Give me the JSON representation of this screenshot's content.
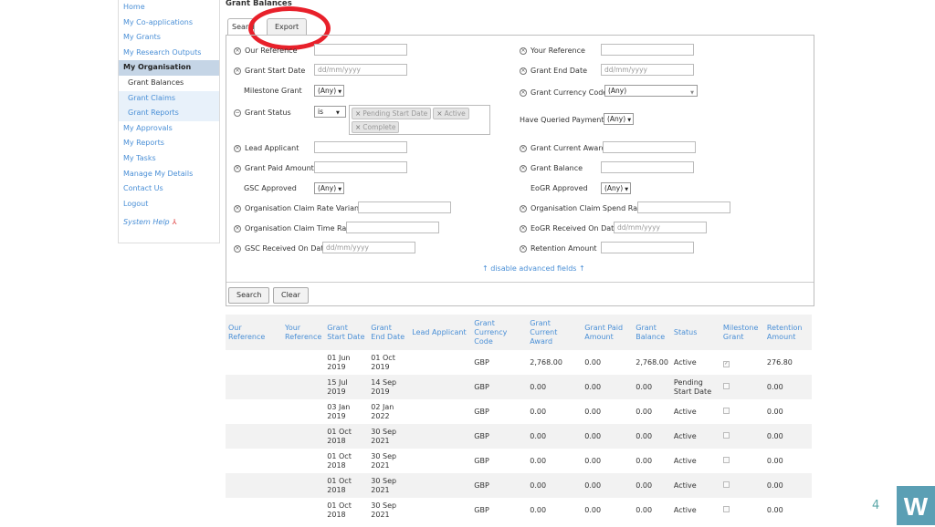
{
  "sidebar": {
    "items": [
      {
        "label": "Home",
        "type": "link"
      },
      {
        "label": "My Co-applications",
        "type": "link"
      },
      {
        "label": "My Grants",
        "type": "link"
      },
      {
        "label": "My Research Outputs",
        "type": "link"
      },
      {
        "label": "My Organisation",
        "type": "active"
      },
      {
        "label": "Grant Balances",
        "type": "sub-current"
      },
      {
        "label": "Grant Claims",
        "type": "sub"
      },
      {
        "label": "Grant Reports",
        "type": "sub"
      },
      {
        "label": "My Approvals",
        "type": "link"
      },
      {
        "label": "My Reports",
        "type": "link"
      },
      {
        "label": "My Tasks",
        "type": "link"
      },
      {
        "label": "Manage My Details",
        "type": "link"
      },
      {
        "label": "Contact Us",
        "type": "link"
      },
      {
        "label": "Logout",
        "type": "link"
      }
    ],
    "help": "System Help"
  },
  "page_title": "Grant Balances",
  "tabs": {
    "search": "Search",
    "export": "Export"
  },
  "form": {
    "our_reference": "Our Reference",
    "your_reference": "Your Reference",
    "grant_start_date": "Grant Start Date",
    "grant_end_date": "Grant End Date",
    "date_placeholder": "dd/mm/yyyy",
    "milestone_grant": "Milestone Grant",
    "grant_currency_code": "Grant Currency Code",
    "any": "(Any)",
    "grant_status": "Grant Status",
    "status_operator": "is",
    "status_tags": [
      "Pending Start Date",
      "Active",
      "Complete"
    ],
    "have_queried_payments": "Have Queried Payments",
    "lead_applicant": "Lead Applicant",
    "grant_current_award": "Grant Current Award",
    "grant_paid_amount": "Grant Paid Amount",
    "grant_balance": "Grant Balance",
    "gsc_approved": "GSC Approved",
    "eogr_approved": "EoGR Approved",
    "org_claim_rate_variance": "Organisation Claim Rate Variance",
    "org_claim_spend_rate": "Organisation Claim Spend Rate",
    "org_claim_time_rate": "Organisation Claim Time Rate",
    "eogr_received_on_date": "EoGR Received On Date",
    "gsc_received_on_date": "GSC Received On Date",
    "retention_amount": "Retention Amount",
    "disable_advanced": "↑ disable advanced fields ↑",
    "search_button": "Search",
    "clear_button": "Clear"
  },
  "table": {
    "headers": [
      "Our Reference",
      "Your Reference",
      "Grant Start Date",
      "Grant End Date",
      "Lead Applicant",
      "Grant Currency Code",
      "Grant Current Award",
      "Grant Paid Amount",
      "Grant Balance",
      "Status",
      "Milestone Grant",
      "Retention Amount"
    ],
    "rows": [
      [
        "",
        "",
        "01 Jun 2019",
        "01 Oct 2019",
        "",
        "GBP",
        "2,768.00",
        "0.00",
        "2,768.00",
        "Active",
        true,
        "276.80"
      ],
      [
        "",
        "",
        "15 Jul 2019",
        "14 Sep 2019",
        "",
        "GBP",
        "0.00",
        "0.00",
        "0.00",
        "Pending Start Date",
        false,
        "0.00"
      ],
      [
        "",
        "",
        "03 Jan 2019",
        "02 Jan 2022",
        "",
        "GBP",
        "0.00",
        "0.00",
        "0.00",
        "Active",
        false,
        "0.00"
      ],
      [
        "",
        "",
        "01 Oct 2018",
        "30 Sep 2021",
        "",
        "GBP",
        "0.00",
        "0.00",
        "0.00",
        "Active",
        false,
        "0.00"
      ],
      [
        "",
        "",
        "01 Oct 2018",
        "30 Sep 2021",
        "",
        "GBP",
        "0.00",
        "0.00",
        "0.00",
        "Active",
        false,
        "0.00"
      ],
      [
        "",
        "",
        "01 Oct 2018",
        "30 Sep 2021",
        "",
        "GBP",
        "0.00",
        "0.00",
        "0.00",
        "Active",
        false,
        "0.00"
      ],
      [
        "",
        "",
        "01 Oct 2018",
        "30 Sep 2021",
        "",
        "GBP",
        "0.00",
        "0.00",
        "0.00",
        "Active",
        false,
        "0.00"
      ]
    ]
  },
  "slide_number": "4",
  "brand_logo_letter": "W",
  "colors": {
    "link": "#4a8fd6",
    "highlight_ring": "#e8202a",
    "logo": "#5b9fb4"
  }
}
